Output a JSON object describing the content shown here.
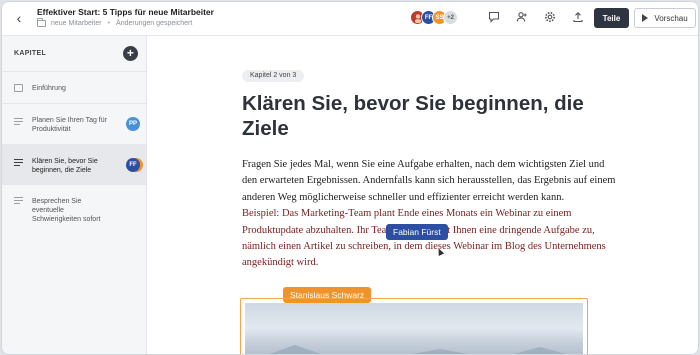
{
  "header": {
    "title": "Effektiver Start: 5 Tipps für neue Mitarbeiter",
    "folder": "neue Mitarbeiter",
    "status": "Änderungen gespeichert",
    "avatars": [
      {
        "initials": "",
        "color": "#c0392b"
      },
      {
        "initials": "FF",
        "color": "#2d4fa3"
      },
      {
        "initials": "SS",
        "color": "#f0932b"
      },
      {
        "initials": "+2",
        "color": "#d9dce1"
      }
    ],
    "share_label": "Teile",
    "preview_label": "Vorschau"
  },
  "sidebar": {
    "title": "KAPITEL",
    "items": [
      {
        "label": "Einführung",
        "icon": "page-icon"
      },
      {
        "label": "Planen Sie Ihren Tag für Produktivität",
        "icon": "text-icon",
        "avatar": "PP",
        "avatar_color": "#4a90d9"
      },
      {
        "label": "Klären Sie, bevor Sie beginnen, die Ziele",
        "icon": "text-icon",
        "avatar": "FF",
        "avatar_color": "#2d4fa3"
      },
      {
        "label": "Besprechen Sie eventuelle Schwierigkeiten sofort",
        "icon": "text-icon"
      }
    ]
  },
  "main": {
    "chapter_chip": "Kapitel 2 von 3",
    "heading": "Klären Sie, bevor Sie beginnen, die Ziele",
    "paragraph": "Fragen Sie jedes Mal, wenn Sie eine Aufgabe erhalten, nach dem wichtigsten Ziel und den erwarteten Ergebnissen. Andernfalls kann sich herausstellen, das Ergebnis auf einem anderen Weg möglicherweise schneller und effizienter erreicht werden kann.",
    "example": "Beispiel: Das Marketing-Team plant Ende eines Monats ein Webinar zu einem Produktupdate abzuhalten. Ihr Teamkollege weist Ihnen eine dringende Aufgabe zu, nämlich einen Artikel zu schreiben, in dem dieses Webinar im Blog des Unternehmens angekündigt wird.",
    "cursor_tags": [
      {
        "name": "Fabian Fürst",
        "color": "#2d4fa3"
      },
      {
        "name": "Stanislaus Schwarz",
        "color": "#f0932b"
      }
    ]
  }
}
